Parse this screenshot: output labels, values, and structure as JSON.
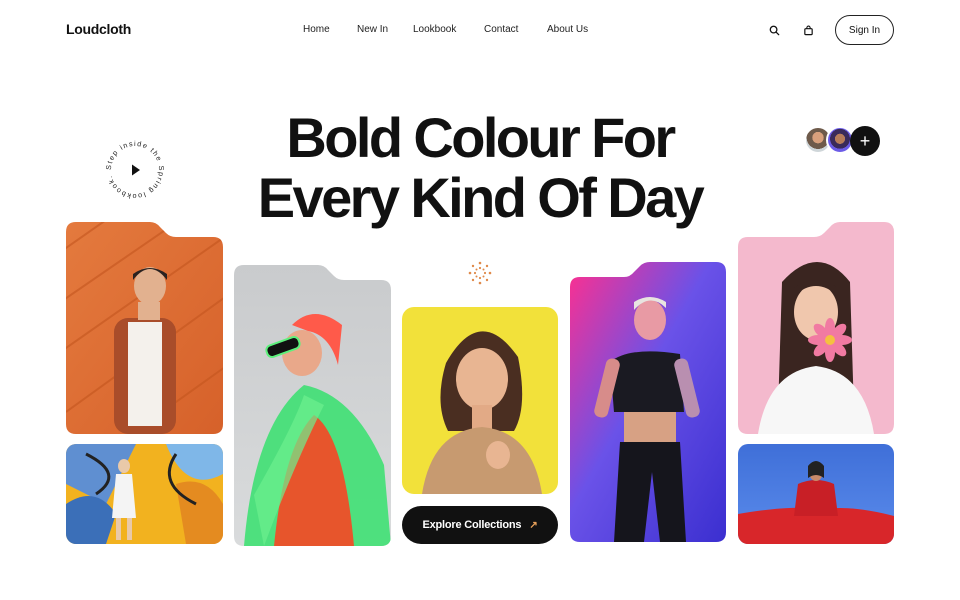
{
  "header": {
    "logo": "Loudcloth",
    "nav": [
      "Home",
      "New In",
      "Lookbook",
      "Contact",
      "About Us"
    ],
    "sign_in": "Sign In"
  },
  "icons": {
    "search": "search-icon",
    "cart": "shopping-bag-icon",
    "play": "play-icon",
    "plus": "plus-icon",
    "arrow": "arrow-up-right-icon"
  },
  "hero": {
    "title_line1": "Bold Colour For",
    "title_line2": "Every Kind Of Day",
    "circular_text": "Step inside the Spring lookbook.",
    "plus_symbol": "+"
  },
  "cta": {
    "label": "Explore Collections",
    "arrow": "↗"
  },
  "colors": {
    "accent": "#111111",
    "arrow": "#e8a15a",
    "card_orange": "#e0733a",
    "card_yellow": "#f2e13a",
    "card_pink": "#f4b8cc",
    "card_blue": "#3d6fd6"
  }
}
